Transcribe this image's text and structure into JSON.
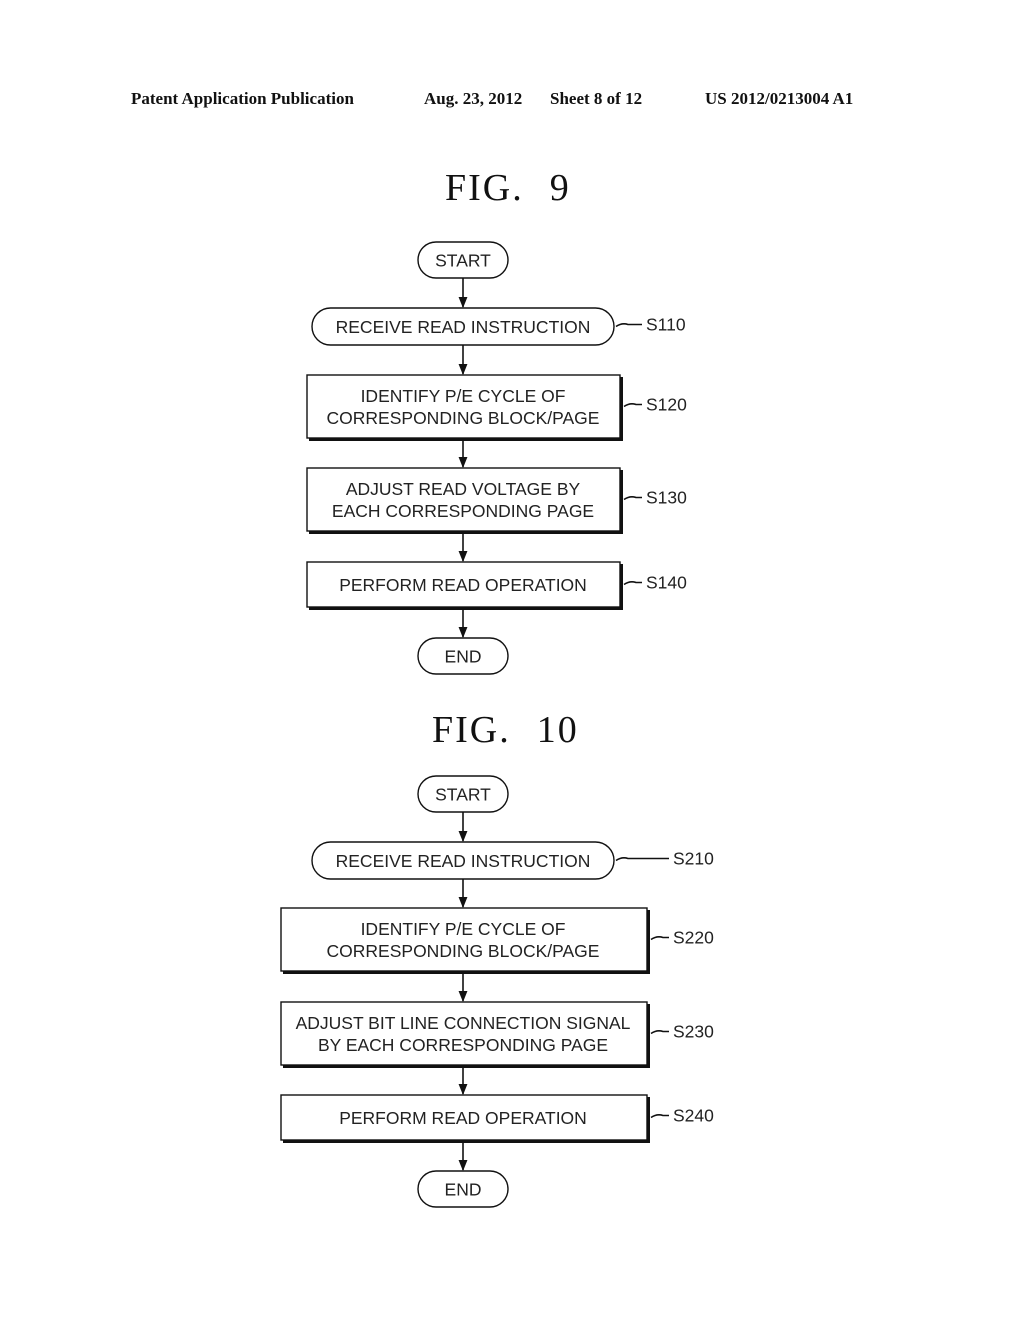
{
  "header": {
    "publication_type": "Patent Application Publication",
    "date": "Aug. 23, 2012",
    "sheet": "Sheet 8 of 12",
    "patent_number": "US 2012/0213004 A1"
  },
  "figures": [
    {
      "label": "FIG.",
      "number": "9",
      "start": "START",
      "end": "END",
      "steps": [
        {
          "ref": "S110",
          "shape": "rounded",
          "lines": [
            "RECEIVE READ INSTRUCTION"
          ]
        },
        {
          "ref": "S120",
          "shape": "box",
          "lines": [
            "IDENTIFY P/E CYCLE OF",
            "CORRESPONDING BLOCK/PAGE"
          ]
        },
        {
          "ref": "S130",
          "shape": "box",
          "lines": [
            "ADJUST READ VOLTAGE BY",
            "EACH CORRESPONDING PAGE"
          ]
        },
        {
          "ref": "S140",
          "shape": "box",
          "lines": [
            "PERFORM READ OPERATION"
          ]
        }
      ]
    },
    {
      "label": "FIG.",
      "number": "10",
      "start": "START",
      "end": "END",
      "steps": [
        {
          "ref": "S210",
          "shape": "rounded",
          "lines": [
            "RECEIVE READ INSTRUCTION"
          ]
        },
        {
          "ref": "S220",
          "shape": "box",
          "lines": [
            "IDENTIFY P/E CYCLE OF",
            "CORRESPONDING BLOCK/PAGE"
          ]
        },
        {
          "ref": "S230",
          "shape": "box",
          "lines": [
            "ADJUST BIT LINE CONNECTION SIGNAL",
            "BY EACH CORRESPONDING PAGE"
          ]
        },
        {
          "ref": "S240",
          "shape": "box",
          "lines": [
            "PERFORM READ OPERATION"
          ]
        }
      ]
    }
  ]
}
